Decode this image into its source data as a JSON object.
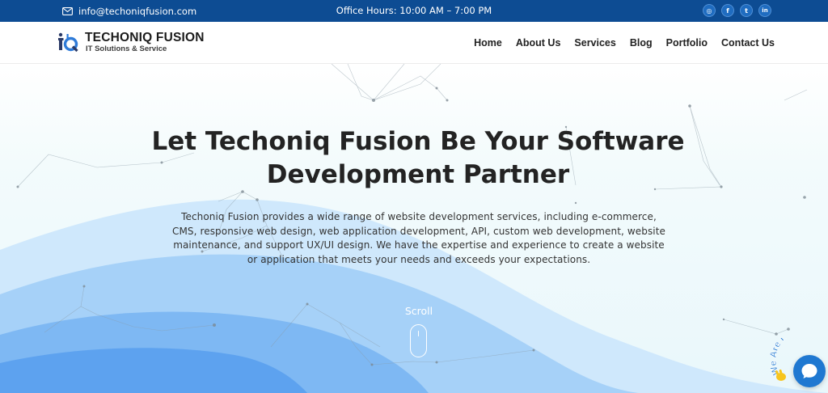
{
  "topbar": {
    "email": "info@techoniqfusion.com",
    "hours": "Office Hours: 10:00 AM – 7:00 PM",
    "socials": [
      {
        "name": "instagram-icon",
        "glyph": "◎"
      },
      {
        "name": "facebook-icon",
        "glyph": "f"
      },
      {
        "name": "twitter-icon",
        "glyph": "t"
      },
      {
        "name": "linkedin-icon",
        "glyph": "in"
      }
    ]
  },
  "header": {
    "logo_title": "TECHONIQ FUSION",
    "logo_subtitle": "IT Solutions & Service",
    "nav": [
      "Home",
      "About Us",
      "Services",
      "Blog",
      "Portfolio",
      "Contact Us"
    ]
  },
  "hero": {
    "title": "Let Techoniq Fusion Be Your Software Development Partner",
    "description": "Techoniq Fusion provides a wide range of website development services, including e-commerce, CMS, responsive web design, web application development, API, custom web development, website maintenance, and support UX/UI design. We have the expertise and experience to create a website or application that meets your needs and exceeds your expectations.",
    "scroll_label": "Scroll"
  },
  "chat": {
    "badge_text": "We Are Here"
  },
  "colors": {
    "topbar": "#0d4c93",
    "accent": "#1f78d1",
    "wave_dark": "#4f9cf1",
    "wave_mid": "#86bff7",
    "wave_light": "#bfe0fb"
  }
}
